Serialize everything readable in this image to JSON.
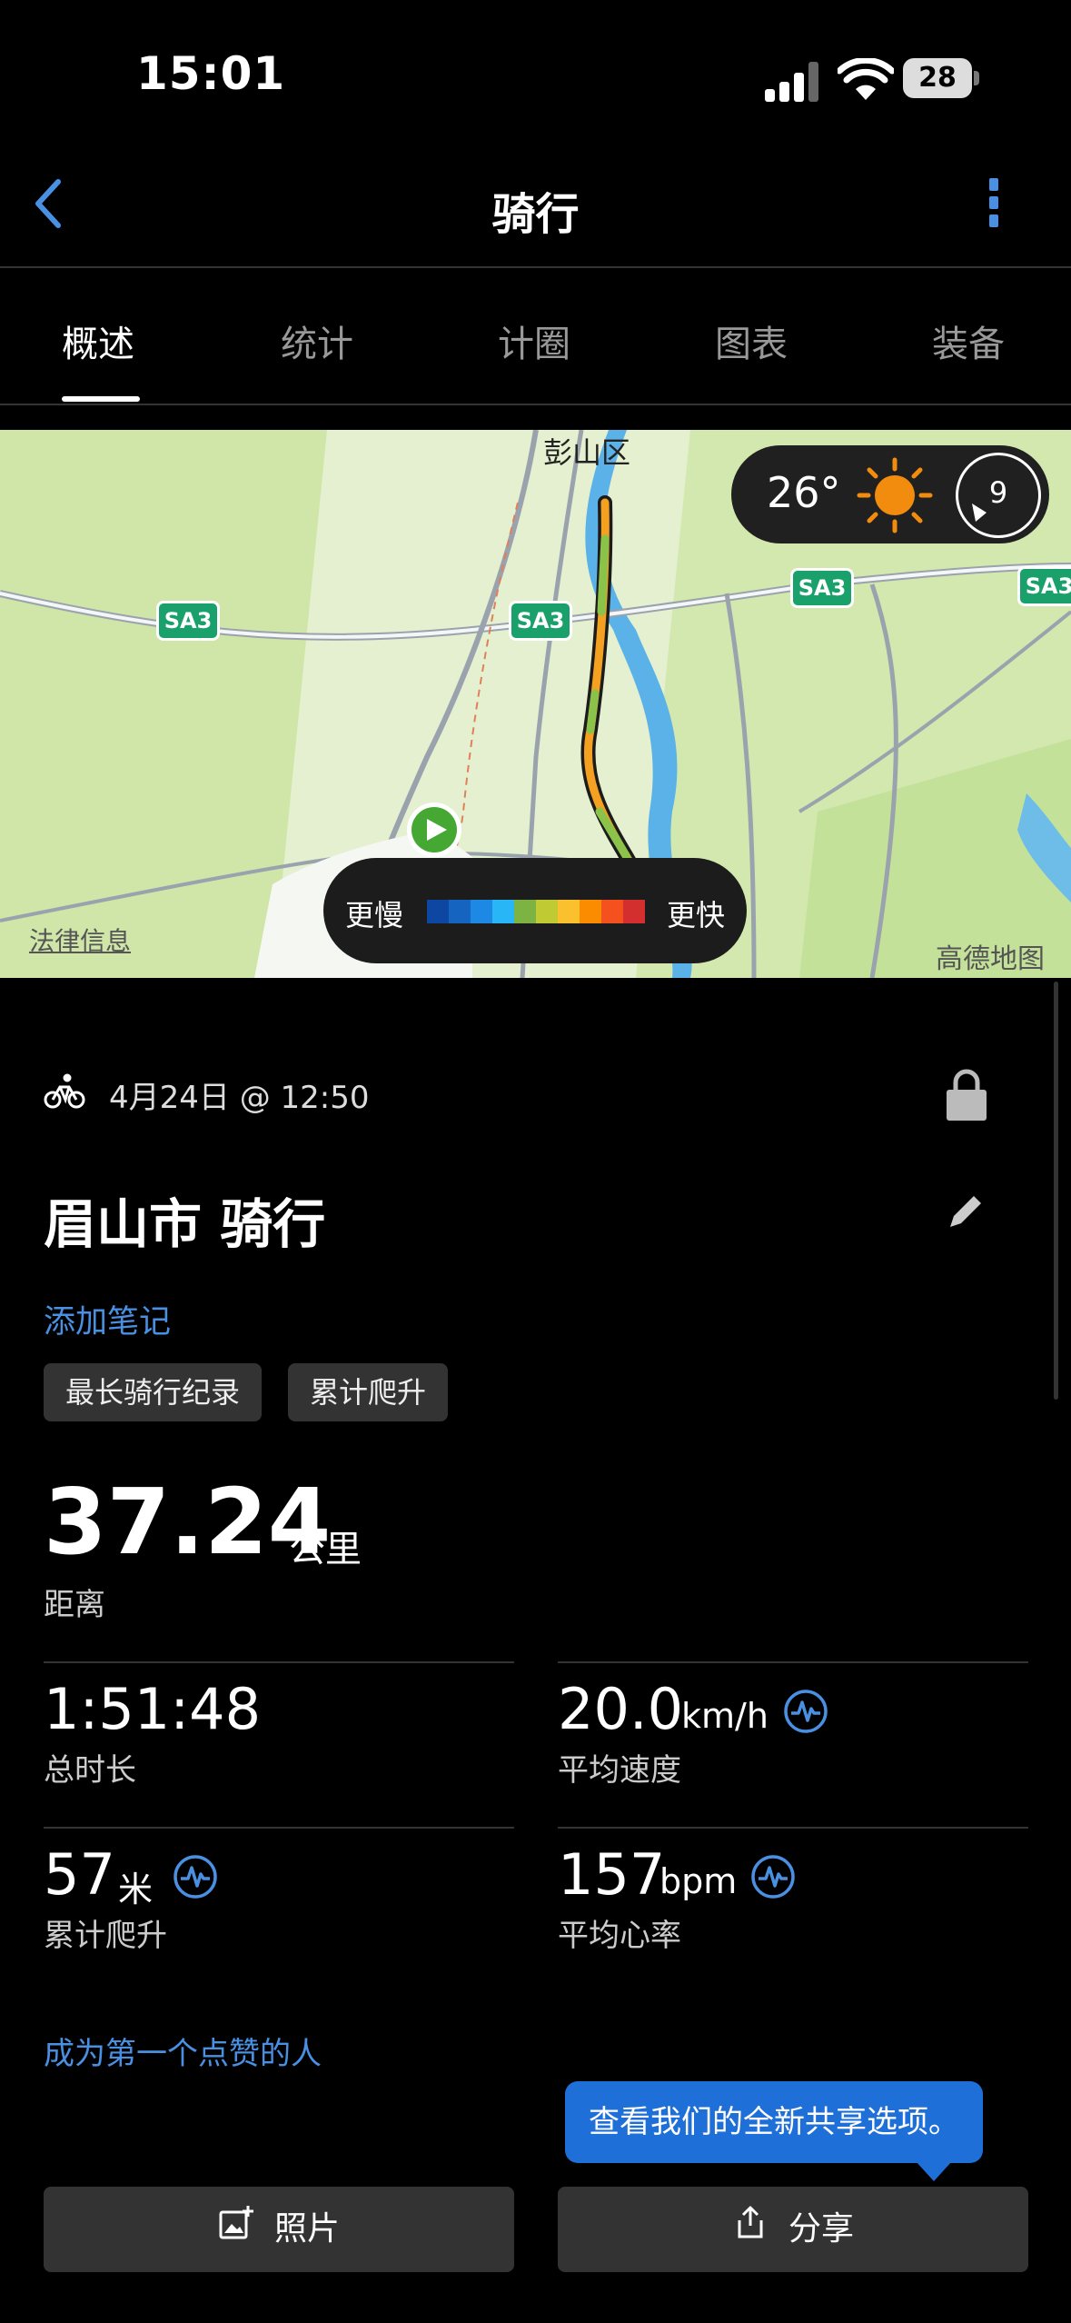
{
  "status_bar": {
    "time": "15:01",
    "battery": "28"
  },
  "header": {
    "title": "骑行"
  },
  "tabs": [
    "概述",
    "统计",
    "计圈",
    "图表",
    "装备"
  ],
  "map": {
    "district_label": "彭山区",
    "road_labels": [
      "SA3",
      "SA3",
      "SA3",
      "SA3"
    ],
    "weather": {
      "temperature": "26°",
      "wind_speed": "9",
      "icon": "sun-icon"
    },
    "speed_legend": {
      "slow": "更慢",
      "fast": "更快",
      "colors": [
        "#0d47a1",
        "#1565c0",
        "#1e88e5",
        "#29b6f6",
        "#7cb342",
        "#c0ca33",
        "#fbc02d",
        "#fb8c00",
        "#f4511e",
        "#d32f2f"
      ]
    },
    "legal_link": "法律信息",
    "provider": "高德地图"
  },
  "activity": {
    "date": "4月24日 @ 12:50",
    "name": "眉山市 骑行",
    "add_note": "添加笔记",
    "badges": [
      "最长骑行纪录",
      "累计爬升"
    ],
    "distance": {
      "value": "37.24",
      "unit": "公里",
      "label": "距离"
    },
    "stats": [
      {
        "value": "1:51:48",
        "unit": "",
        "label": "总时长"
      },
      {
        "value": "20.0",
        "unit": "km/h",
        "label": "平均速度"
      },
      {
        "value": "57",
        "unit": "米",
        "label": "累计爬升"
      },
      {
        "value": "157",
        "unit": "bpm",
        "label": "平均心率"
      }
    ],
    "like_prompt": "成为第一个点赞的人"
  },
  "share_tooltip": "查看我们的全新共享选项。",
  "buttons": {
    "photos": "照片",
    "share": "分享"
  },
  "colors": {
    "accent": "#4a90e2",
    "tooltip": "#1f6fd8"
  }
}
